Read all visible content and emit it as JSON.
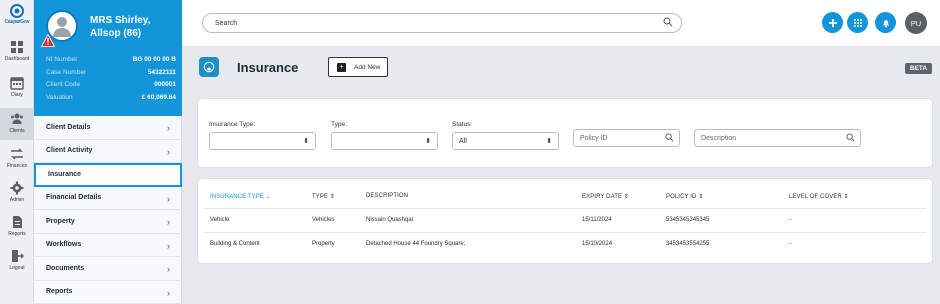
{
  "app": {
    "logo_text": "CasparGov"
  },
  "rail": [
    {
      "label": "Dashboard",
      "icon": "grid-icon"
    },
    {
      "label": "Diary",
      "icon": "calendar-icon"
    },
    {
      "label": "Clients",
      "icon": "users-icon"
    },
    {
      "label": "Finances",
      "icon": "transfer-icon"
    },
    {
      "label": "Admin",
      "icon": "gear-icon"
    },
    {
      "label": "Reports",
      "icon": "report-icon"
    },
    {
      "label": "Logout",
      "icon": "logout-icon"
    }
  ],
  "client": {
    "name": "MRS Shirley, Allsop (86)",
    "fields": [
      {
        "key": "NI Number",
        "value": "BG 00 00 00 B"
      },
      {
        "key": "Case Number",
        "value": "54322111"
      },
      {
        "key": "Client Code",
        "value": "000001"
      },
      {
        "key": "Valuation",
        "value": "£ 60,069.84"
      }
    ]
  },
  "menu": [
    {
      "label": "Client Details",
      "chevron": "›"
    },
    {
      "label": "Client Activity",
      "chevron": "›"
    },
    {
      "label": "Insurance",
      "chevron": ""
    },
    {
      "label": "Financial Details",
      "chevron": "›"
    },
    {
      "label": "Property",
      "chevron": "›"
    },
    {
      "label": "Workflows",
      "chevron": "›"
    },
    {
      "label": "Documents",
      "chevron": "›"
    },
    {
      "label": "Reports",
      "chevron": "›"
    }
  ],
  "topbar": {
    "search_placeholder": "Search",
    "user_initials": "PU"
  },
  "page": {
    "title": "Insurance",
    "add_new_label": "Add New",
    "badge": "BETA"
  },
  "filters": {
    "insurance_type": {
      "label": "Insurance Type:",
      "value": ""
    },
    "type": {
      "label": "Type:",
      "value": ""
    },
    "status": {
      "label": "Status:",
      "value": "All"
    },
    "policy_id_placeholder": "Policy ID",
    "description_placeholder": "Description"
  },
  "table": {
    "headers": [
      "INSURANCE TYPE",
      "TYPE",
      "DESCRIPTION",
      "EXPIRY DATE",
      "POLICY ID",
      "LEVEL OF COVER"
    ],
    "rows": [
      [
        "Vehicle",
        "Vehicles",
        "Nissain Quashqai",
        "15/11/2024",
        "5345345345345",
        "-"
      ],
      [
        "Building & Content",
        "Property",
        "Detached House 44 Foundry Square;",
        "15/10/2024",
        "3453453554255",
        "-"
      ]
    ]
  },
  "colors": {
    "accent": "#1396d9",
    "badge": "#5c6470"
  }
}
